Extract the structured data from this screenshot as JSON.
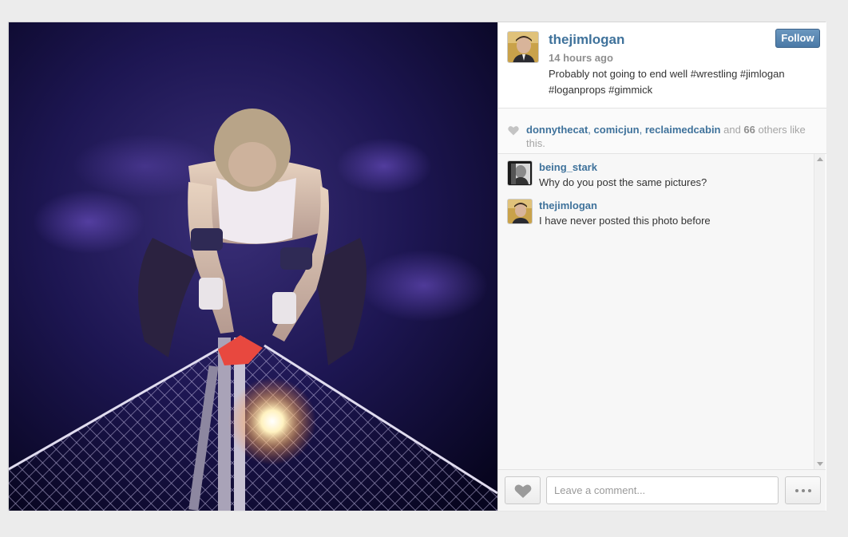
{
  "post": {
    "image_alt": "wrestler on steel cage",
    "owner": {
      "username": "thejimlogan",
      "time_ago": "14 hours ago",
      "avatar_icon": "profile-photo"
    },
    "follow_label": "Follow",
    "caption": "Probably not going to end well #wrestling #jimlogan #loganprops #gimmick"
  },
  "likes": {
    "users": [
      "donnythecat",
      "comicjun",
      "reclaimedcabin"
    ],
    "sep1": ", ",
    "sep2": ", ",
    "and_text": " and ",
    "others_count": "66",
    "suffix": " others like this."
  },
  "comments": [
    {
      "username": "being_stark",
      "text": "Why do you post the same pictures?"
    },
    {
      "username": "thejimlogan",
      "text": "I have never posted this photo before"
    }
  ],
  "footer": {
    "comment_placeholder": "Leave a comment...",
    "like_icon": "heart-icon",
    "more_icon": "ellipsis-icon"
  },
  "colors": {
    "link": "#3f729b",
    "follow_button": "#517fa4",
    "background": "#ececec"
  }
}
